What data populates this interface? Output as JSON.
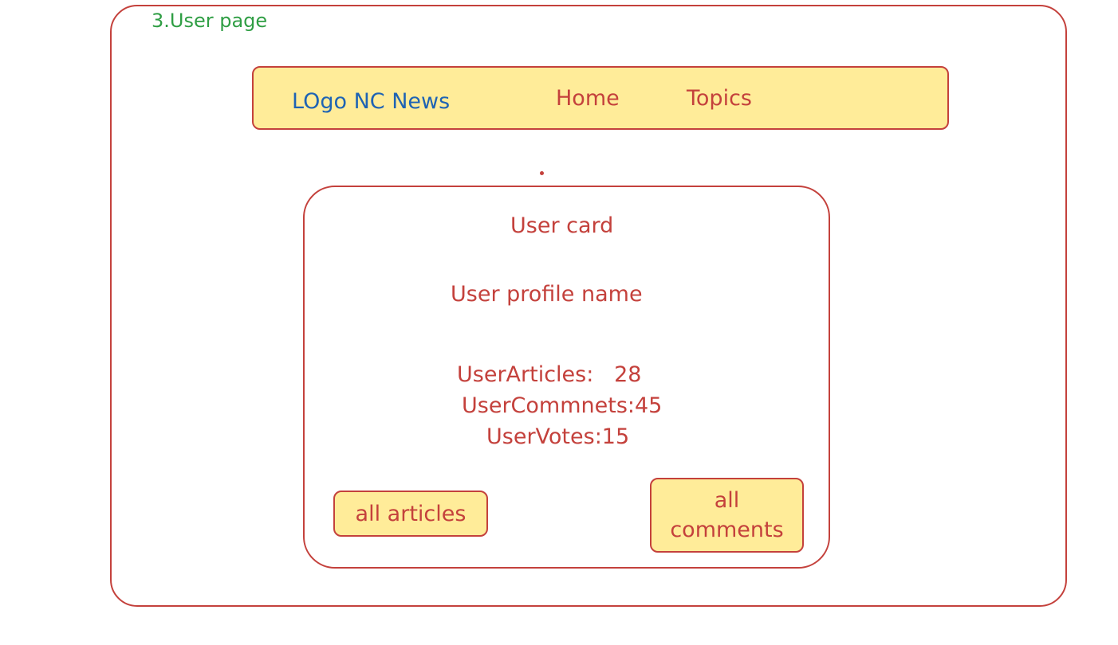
{
  "page_title": "3.User page",
  "navbar": {
    "logo": "LOgo NC News",
    "home": "Home",
    "topics": "Topics"
  },
  "user_card": {
    "title": "User card",
    "profile_name": "User profile name",
    "stats": {
      "articles": "UserArticles:   28",
      "comments": "UserCommnets:45",
      "votes": "UserVotes:15"
    },
    "buttons": {
      "all_articles": "all articles",
      "all_comments": "all\ncomments"
    }
  },
  "colors": {
    "stroke": "#c4413c",
    "fill_yellow": "#ffec99",
    "title_green": "#2f9e44",
    "logo_blue": "#1e63b4"
  }
}
